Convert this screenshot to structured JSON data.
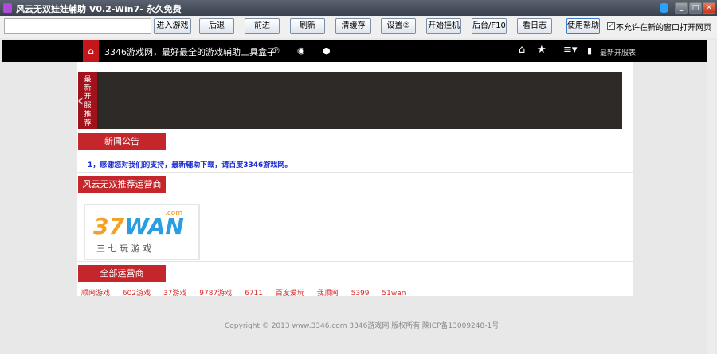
{
  "window": {
    "title": "风云无双娃娃辅助 V0.2-Win7- 永久免费"
  },
  "toolbar": {
    "url_value": "",
    "buttons": [
      "进入游戏",
      "后退",
      "前进",
      "刷新",
      "清缓存",
      "设置②",
      "开始挂机",
      "后台/F10",
      "看日志",
      "使用帮助"
    ],
    "checkbox_label": "不允许在新的窗口打开网页",
    "checkbox_checked": true
  },
  "nav": {
    "site_title": "3346游戏网，最好最全的游戏辅助工具盒子",
    "right_link": "最新开服表"
  },
  "banner": {
    "side_label": "最新开服推荐"
  },
  "sections": {
    "news_title": "新闻公告",
    "news_item": "1，感谢您对我们的支持，最新辅助下载，请百度3346游戏网。",
    "recommend_title": "风云无双推荐运营商",
    "logo_text": "37WAN",
    "logo_sub": "三 七 玩 游 戏",
    "logo_com": ".com",
    "all_title": "全部运营商",
    "operators": [
      "顺网游戏",
      "602游戏",
      "37游戏",
      "9787游戏",
      "6711",
      "百度爱玩",
      "我顶网",
      "5399",
      "51wan"
    ]
  },
  "footer": {
    "copyright": "Copyright © 2013 www.3346.com 3346游戏网 版权所有 陕ICP备13009248-1号"
  }
}
